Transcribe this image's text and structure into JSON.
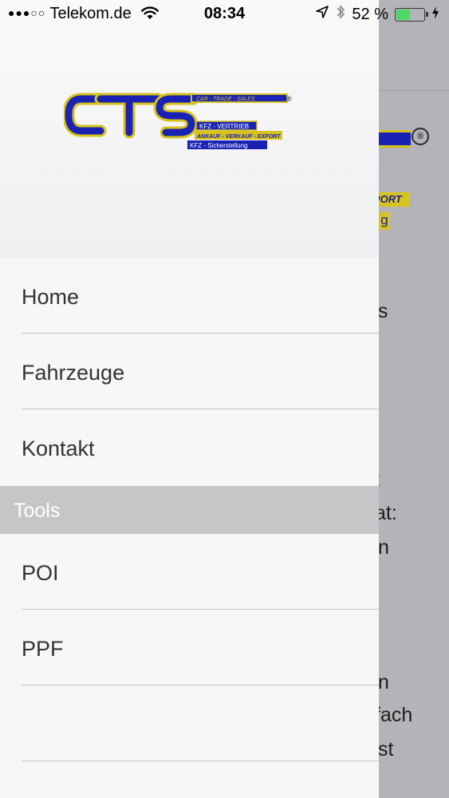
{
  "status_bar": {
    "signal_dots": "●●●○○",
    "carrier": "Telekom.de",
    "wifi_icon": "wifi-icon",
    "time": "08:34",
    "location_icon": "location-arrow-icon",
    "bluetooth_icon": "bluetooth-icon",
    "battery_percent": "52 %",
    "battery_level": 0.52,
    "charging_icon": "charging-bolt-icon"
  },
  "logo": {
    "brand": "CTS",
    "tagline": "CAR - TRADE - SALES",
    "line1": "KFZ - VERTRIEB",
    "line2": "ANKAUF - VERKAUF - EXPORT",
    "line3": "KFZ - Sicherstellung",
    "registered": "®"
  },
  "menu": {
    "items": [
      {
        "label": "Home"
      },
      {
        "label": "Fahrzeuge"
      },
      {
        "label": "Kontakt"
      }
    ],
    "section_tools": "Tools",
    "tools_items": [
      {
        "label": "POI"
      },
      {
        "label": "PPF"
      },
      {
        "label": ""
      }
    ]
  },
  "background_fragments": {
    "f1": "s",
    "f2": "t",
    "f3": "at:",
    "f4": "n",
    "f5": "n",
    "f6": "fach",
    "f7": "st",
    "export_text": "PORT",
    "g_text": "g",
    "registered": "®"
  },
  "colors": {
    "accent_blue": "#1a22b4",
    "accent_yellow": "#d6c21c",
    "battery_green": "#4cd964",
    "section_bg": "#c6c5c8"
  }
}
